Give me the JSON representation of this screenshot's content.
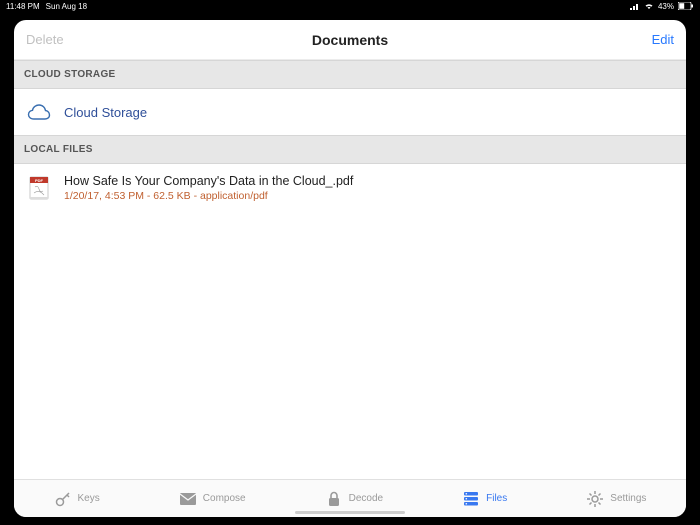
{
  "status_bar": {
    "time": "11:48 PM",
    "date": "Sun Aug 18",
    "battery_text": "43%"
  },
  "nav": {
    "left": "Delete",
    "title": "Documents",
    "right": "Edit"
  },
  "sections": {
    "cloud_header": "CLOUD STORAGE",
    "cloud_item_label": "Cloud Storage",
    "local_header": "LOCAL FILES"
  },
  "files": [
    {
      "name": "How Safe Is Your Company's Data in the Cloud_.pdf",
      "meta": "1/20/17, 4:53 PM - 62.5 KB - application/pdf"
    }
  ],
  "tabs": {
    "keys": "Keys",
    "compose": "Compose",
    "decode": "Decode",
    "files": "Files",
    "settings": "Settings"
  },
  "colors": {
    "accent": "#3878f0",
    "link": "#2879ff",
    "meta": "#c06030"
  }
}
